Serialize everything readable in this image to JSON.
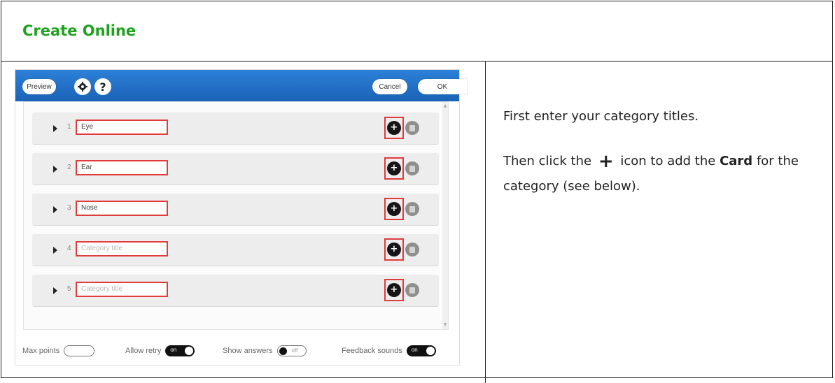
{
  "header": {
    "title": "Create Online"
  },
  "app": {
    "toolbar": {
      "preview_label": "Preview",
      "gear_icon": "gear-icon",
      "help_glyph": "?",
      "cancel_label": "Cancel",
      "ok_label": "OK"
    },
    "rows": [
      {
        "num": "1",
        "value": "Eye",
        "placeholder": ""
      },
      {
        "num": "2",
        "value": "Ear",
        "placeholder": ""
      },
      {
        "num": "3",
        "value": "Nose",
        "placeholder": ""
      },
      {
        "num": "4",
        "value": "",
        "placeholder": "Category title"
      },
      {
        "num": "5",
        "value": "",
        "placeholder": "Category title"
      }
    ],
    "add_glyph": "+",
    "bottom": {
      "max_points_label": "Max points",
      "allow_retry_label": "Allow retry",
      "allow_retry_state": "on",
      "show_answers_label": "Show answers",
      "show_answers_state": "off",
      "feedback_sounds_label": "Feedback sounds",
      "feedback_sounds_state": "on"
    }
  },
  "instructions": {
    "line1": "First enter your category titles.",
    "line2_pre": "Then click the",
    "plus_glyph": "+",
    "line2_mid": "icon to add the",
    "line2_bold": "Card",
    "line2_post": "for the category (see below)."
  },
  "colors": {
    "header_title": "#1ea21e",
    "toolbar_blue": "#1f6bc2",
    "highlight_red": "#e03c3c"
  }
}
